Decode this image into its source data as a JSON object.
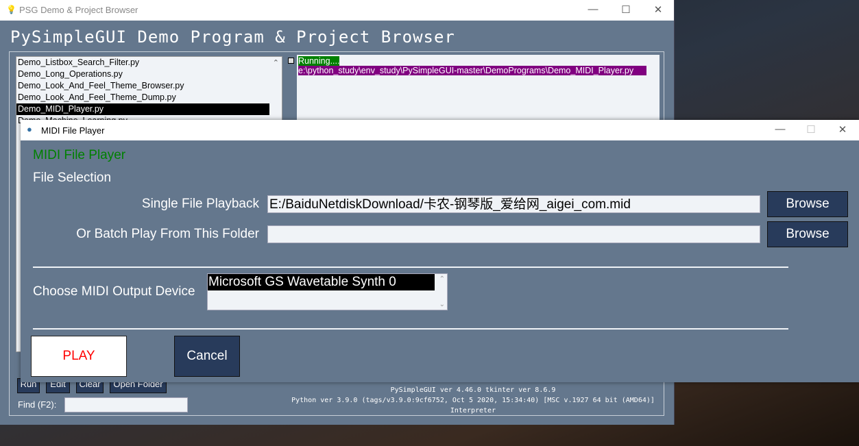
{
  "main": {
    "window_title": "PSG Demo & Project Browser",
    "heading": "PySimpleGUI Demo Program & Project Browser",
    "files": [
      "Demo_Listbox_Search_Filter.py",
      "Demo_Long_Operations.py",
      "Demo_Look_And_Feel_Theme_Browser.py",
      "Demo_Look_And_Feel_Theme_Dump.py",
      "Demo_MIDI_Player.py",
      "Demo_Machine_Learning.py"
    ],
    "selected_file": "Demo_MIDI_Player.py",
    "output": {
      "running": "Running....",
      "path": "e:\\python_study\\env_study\\PySimpleGUI-master\\DemoPrograms\\Demo_MIDI_Player.py"
    },
    "buttons": {
      "run": "Run",
      "edit": "Edit",
      "clear": "Clear",
      "open_folder": "Open Folder"
    },
    "find_label": "Find (F2):",
    "find_value": "",
    "info": [
      "PySimpleGUI ver 4.46.0  tkinter ver 8.6.9",
      "Python ver 3.9.0 (tags/v3.9.0:9cf6752, Oct  5 2020, 15:34:40) [MSC v.1927 64 bit (AMD64)]",
      "Interpreter"
    ]
  },
  "dialog": {
    "window_title": "MIDI File Player",
    "heading": "MIDI File Player",
    "section": "File Selection",
    "single_label": "Single File Playback",
    "single_value": "E:/BaiduNetdiskDownload/卡农-钢琴版_爱给网_aigei_com.mid",
    "batch_label": "Or Batch Play From This Folder",
    "batch_value": "",
    "browse": "Browse",
    "device_label": "Choose MIDI Output Device",
    "devices": [
      "Microsoft GS Wavetable Synth 0"
    ],
    "play": "PLAY",
    "cancel": "Cancel"
  },
  "colors": {
    "bg": "#64778d",
    "button": "#283b5b",
    "heading_green": "#008000",
    "running_bg": "#008000",
    "path_bg": "#800080",
    "play_text": "#ff0000"
  }
}
